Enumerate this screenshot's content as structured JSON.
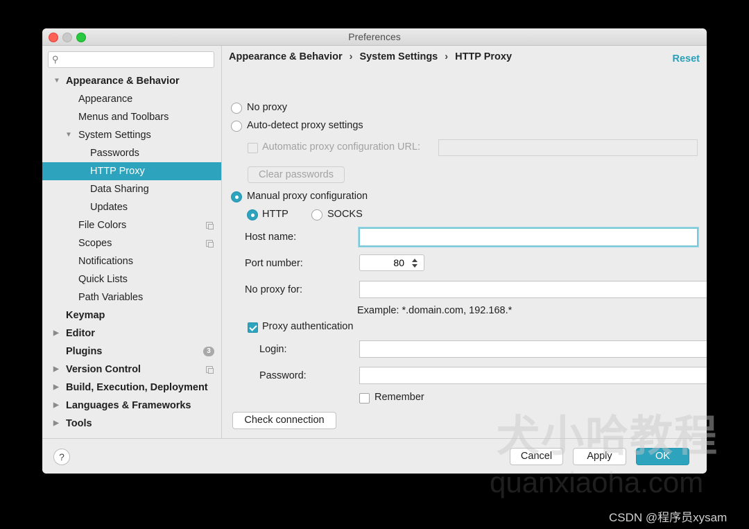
{
  "window": {
    "title": "Preferences"
  },
  "search": {
    "placeholder": "",
    "value": ""
  },
  "sidebar": {
    "items": [
      {
        "label": "Appearance & Behavior",
        "level": 0,
        "expanded": true,
        "bold": true
      },
      {
        "label": "Appearance",
        "level": 1
      },
      {
        "label": "Menus and Toolbars",
        "level": 1
      },
      {
        "label": "System Settings",
        "level": 1,
        "expanded": true
      },
      {
        "label": "Passwords",
        "level": 2
      },
      {
        "label": "HTTP Proxy",
        "level": 2,
        "selected": true
      },
      {
        "label": "Data Sharing",
        "level": 2
      },
      {
        "label": "Updates",
        "level": 2
      },
      {
        "label": "File Colors",
        "level": 1,
        "project_icon": true
      },
      {
        "label": "Scopes",
        "level": 1,
        "project_icon": true
      },
      {
        "label": "Notifications",
        "level": 1
      },
      {
        "label": "Quick Lists",
        "level": 1
      },
      {
        "label": "Path Variables",
        "level": 1
      },
      {
        "label": "Keymap",
        "level": 0,
        "bold": true
      },
      {
        "label": "Editor",
        "level": 0,
        "bold": true,
        "collapsed": true
      },
      {
        "label": "Plugins",
        "level": 0,
        "bold": true,
        "badge": "3"
      },
      {
        "label": "Version Control",
        "level": 0,
        "bold": true,
        "collapsed": true,
        "project_icon": true
      },
      {
        "label": "Build, Execution, Deployment",
        "level": 0,
        "bold": true,
        "collapsed": true
      },
      {
        "label": "Languages & Frameworks",
        "level": 0,
        "bold": true,
        "collapsed": true
      },
      {
        "label": "Tools",
        "level": 0,
        "bold": true,
        "collapsed": true
      }
    ]
  },
  "breadcrumb": {
    "parts": [
      "Appearance & Behavior",
      "System Settings",
      "HTTP Proxy"
    ],
    "separator": "›"
  },
  "reset_label": "Reset",
  "proxy": {
    "no_proxy_label": "No proxy",
    "auto_detect_label": "Auto-detect proxy settings",
    "auto_url_label": "Automatic proxy configuration URL:",
    "auto_url_value": "",
    "clear_passwords_label": "Clear passwords",
    "manual_label": "Manual proxy configuration",
    "http_label": "HTTP",
    "socks_label": "SOCKS",
    "host_label": "Host name:",
    "host_value": "",
    "port_label": "Port number:",
    "port_value": "80",
    "no_proxy_for_label": "No proxy for:",
    "no_proxy_for_value": "",
    "example_text": "Example: *.domain.com, 192.168.*",
    "auth_label": "Proxy authentication",
    "login_label": "Login:",
    "login_value": "",
    "password_label": "Password:",
    "password_value": "",
    "remember_label": "Remember",
    "check_connection_label": "Check connection"
  },
  "footer": {
    "help_label": "?",
    "cancel_label": "Cancel",
    "apply_label": "Apply",
    "ok_label": "OK"
  },
  "watermark": {
    "cn": "犬小哈教程",
    "url": "quanxiaoha.com",
    "credit": "CSDN @程序员xysam"
  },
  "colors": {
    "accent": "#2ea3bd",
    "window_bg": "#ececec",
    "backdrop": "#000000"
  }
}
